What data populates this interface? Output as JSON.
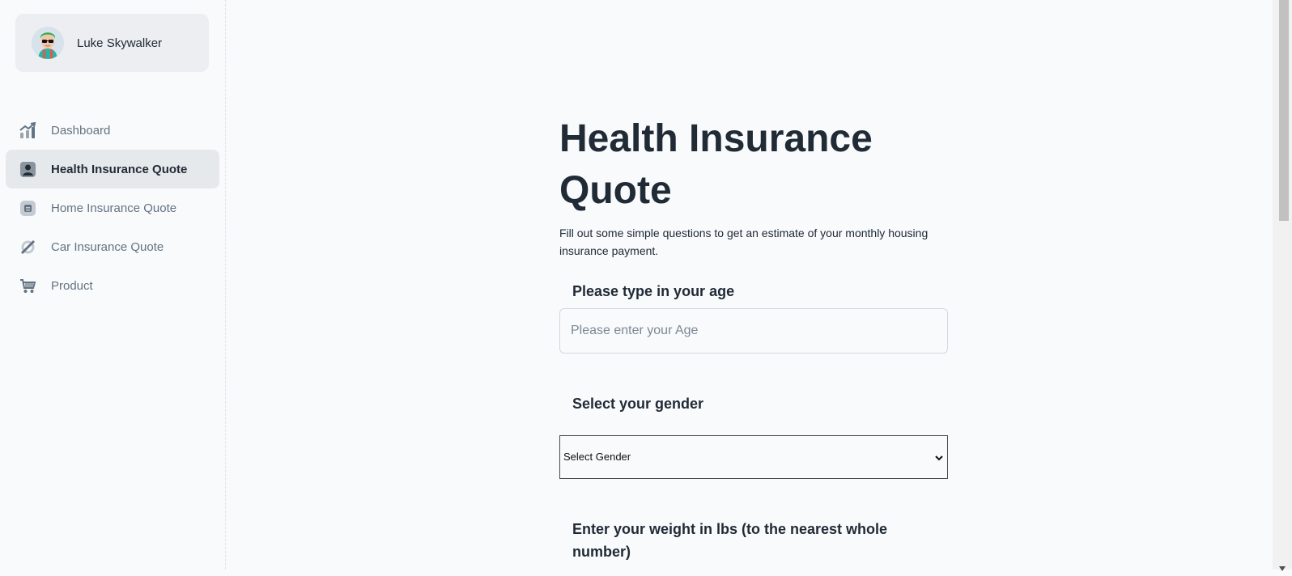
{
  "user": {
    "name": "Luke Skywalker",
    "avatar_icon": "avatar-glasses-icon"
  },
  "sidebar": {
    "items": [
      {
        "label": "Dashboard",
        "icon": "chart-icon",
        "active": false
      },
      {
        "label": "Health Insurance Quote",
        "icon": "user-card-icon",
        "active": true
      },
      {
        "label": "Home Insurance Quote",
        "icon": "document-icon",
        "active": false
      },
      {
        "label": "Car Insurance Quote",
        "icon": "disabled-icon",
        "active": false
      },
      {
        "label": "Product",
        "icon": "cart-icon",
        "active": false
      }
    ]
  },
  "main": {
    "title": "Health Insurance Quote",
    "subtitle": "Fill out some simple questions to get an estimate of your monthly housing insurance payment.",
    "age_label": "Please type in your age",
    "age_placeholder": "Please enter your Age",
    "age_value": "",
    "gender_label": "Select your gender",
    "gender_selected": "Select Gender",
    "weight_label": "Enter your weight in lbs (to the nearest whole number)"
  },
  "colors": {
    "accent_bg": "#e6e9ec",
    "text_primary": "#212b36",
    "text_secondary": "#637381"
  }
}
